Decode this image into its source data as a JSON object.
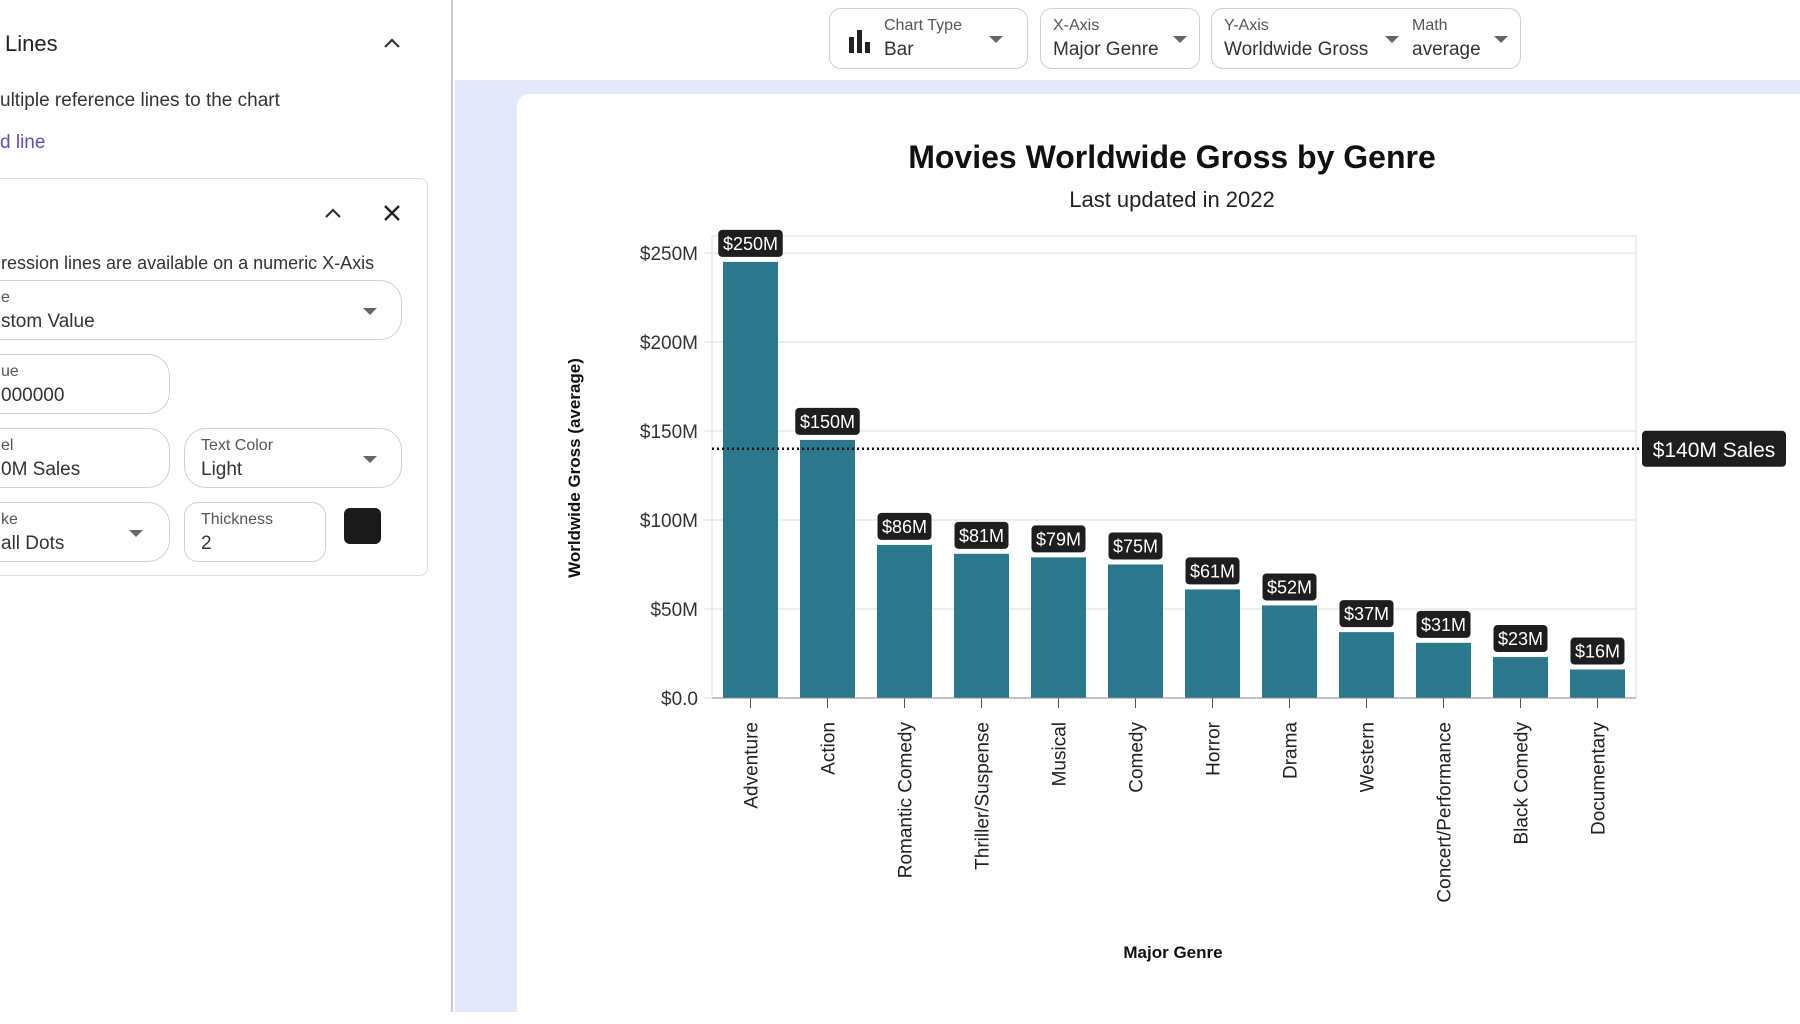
{
  "sidebar": {
    "section_title": "Lines",
    "description": "ultiple reference lines to the chart",
    "add_line": "d line",
    "line_card": {
      "note": "ression lines are available on a numeric X-Axis",
      "type": {
        "label": "e",
        "value": "stom Value"
      },
      "value": {
        "label": "ue",
        "value": "000000"
      },
      "label": {
        "label": "el",
        "value": "0M Sales"
      },
      "text_color": {
        "label": "Text Color",
        "value": "Light"
      },
      "stroke": {
        "label": "ke",
        "value": "all Dots"
      },
      "thickness": {
        "label": "Thickness",
        "value": "2"
      },
      "color": "#1a1a1a"
    }
  },
  "toolbar": {
    "chart_type": {
      "label": "Chart Type",
      "value": "Bar",
      "icon": "bar-chart-icon"
    },
    "x_axis": {
      "label": "X-Axis",
      "value": "Major Genre"
    },
    "y_axis": {
      "label": "Y-Axis",
      "value": "Worldwide Gross"
    },
    "math": {
      "label": "Math",
      "value": "average"
    }
  },
  "colors": {
    "bar": "#2b778c",
    "accent": "#5b4fc0",
    "band": "#e3e8fb"
  },
  "chart_data": {
    "type": "bar",
    "title": "Movies Worldwide Gross by Genre",
    "subtitle": "Last updated in 2022",
    "xlabel": "Major Genre",
    "ylabel": "Worldwide Gross (average)",
    "categories": [
      "Adventure",
      "Action",
      "Romantic Comedy",
      "Thriller/Suspense",
      "Musical",
      "Comedy",
      "Horror",
      "Drama",
      "Western",
      "Concert/Performance",
      "Black Comedy",
      "Documentary"
    ],
    "values": [
      245,
      145,
      86,
      81,
      79,
      75,
      61,
      52,
      37,
      31,
      23,
      16
    ],
    "value_unit": "$M",
    "data_labels": [
      "$250M",
      "$150M",
      "$86M",
      "$81M",
      "$79M",
      "$75M",
      "$61M",
      "$52M",
      "$37M",
      "$31M",
      "$23M",
      "$16M"
    ],
    "yticks": [
      0,
      50,
      100,
      150,
      200,
      250
    ],
    "ytick_labels": [
      "$0.0",
      "$50M",
      "$100M",
      "$150M",
      "$200M",
      "$250M"
    ],
    "ylim": [
      0,
      260
    ],
    "grid": true,
    "reference_line": {
      "value": 140,
      "label": "$140M Sales",
      "style": "dotted"
    }
  }
}
